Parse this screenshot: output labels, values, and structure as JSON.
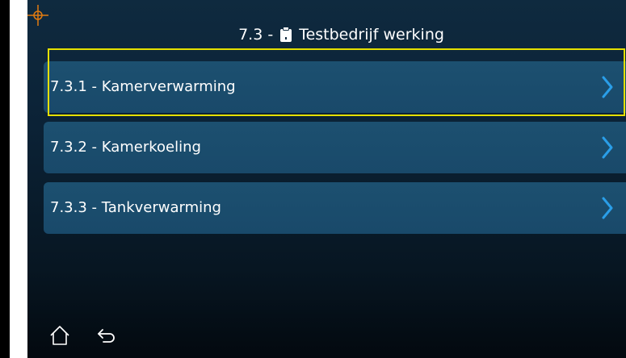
{
  "header": {
    "prefix": "7.3 -",
    "title": "Testbedrijf werking",
    "icon": "clipboard-icon"
  },
  "menu": {
    "items": [
      {
        "label": "7.3.1 - Kamerverwarming",
        "icon": "chevron-right-icon",
        "selected": true
      },
      {
        "label": "7.3.2 - Kamerkoeling",
        "icon": "chevron-right-icon",
        "selected": false
      },
      {
        "label": "7.3.3 - Tankverwarming",
        "icon": "chevron-right-icon",
        "selected": false
      }
    ]
  },
  "footer": {
    "home_icon": "home-icon",
    "back_icon": "back-arrow-icon"
  },
  "colors": {
    "accent": "#e5e000",
    "crosshair": "#e07a10",
    "chevron": "#2a9ee8",
    "item_background": "#1c5070"
  }
}
